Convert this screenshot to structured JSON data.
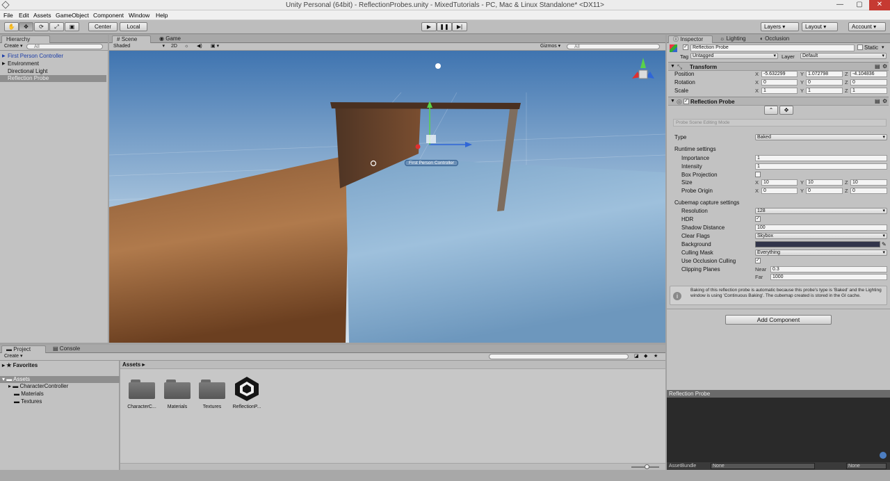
{
  "window": {
    "title": "Unity Personal (64bit) - ReflectionProbes.unity - MixedTutorials - PC, Mac & Linux Standalone* <DX11>"
  },
  "menu": [
    "File",
    "Edit",
    "Assets",
    "GameObject",
    "Component",
    "Window",
    "Help"
  ],
  "toolbar": {
    "pivot_label": "Center",
    "space_label": "Local",
    "layers_label": "Layers",
    "layout_label": "Layout",
    "account_label": "Account"
  },
  "hierarchy": {
    "tab": "Hierarchy",
    "create": "Create",
    "search_placeholder": "All",
    "items": [
      {
        "label": "First Person Controller",
        "selected": false
      },
      {
        "label": "Environment",
        "selected": false
      },
      {
        "label": "Directional Light",
        "selected": false
      },
      {
        "label": "Reflection Probe",
        "selected": true
      }
    ]
  },
  "scene": {
    "tab_scene": "Scene",
    "tab_game": "Game",
    "shading": "Shaded",
    "mode_2d": "2D",
    "gizmos": "Gizmos",
    "search_placeholder": "All",
    "object_label": "First Person Controller"
  },
  "inspector": {
    "tab_inspector": "Inspector",
    "tab_lighting": "Lighting",
    "tab_occlusion": "Occlusion",
    "object_name": "Reflection Probe",
    "static_label": "Static",
    "tag_label": "Tag",
    "tag_value": "Untagged",
    "layer_label": "Layer",
    "layer_value": "Default",
    "transform": {
      "title": "Transform",
      "position": {
        "label": "Position",
        "x": "-5.632299",
        "y": "1.072798",
        "z": "-4.104836"
      },
      "rotation": {
        "label": "Rotation",
        "x": "0",
        "y": "0",
        "z": "0"
      },
      "scale": {
        "label": "Scale",
        "x": "1",
        "y": "1",
        "z": "1"
      }
    },
    "probe": {
      "title": "Reflection Probe",
      "editing_mode": "Probe Scene Editing Mode",
      "type_label": "Type",
      "type_value": "Baked",
      "runtime_settings": "Runtime settings",
      "importance_label": "Importance",
      "importance_value": "1",
      "intensity_label": "Intensity",
      "intensity_value": "1",
      "box_projection_label": "Box Projection",
      "size": {
        "label": "Size",
        "x": "10",
        "y": "10",
        "z": "10"
      },
      "origin": {
        "label": "Probe Origin",
        "x": "0",
        "y": "0",
        "z": "0"
      },
      "cubemap_settings": "Cubemap capture settings",
      "resolution_label": "Resolution",
      "resolution_value": "128",
      "hdr_label": "HDR",
      "shadow_distance_label": "Shadow Distance",
      "shadow_distance_value": "100",
      "clear_flags_label": "Clear Flags",
      "clear_flags_value": "Skybox",
      "background_label": "Background",
      "background_color": "#31344a",
      "culling_mask_label": "Culling Mask",
      "culling_mask_value": "Everything",
      "occlusion_culling_label": "Use Occlusion Culling",
      "clipping_planes_label": "Clipping Planes",
      "near_label": "Near",
      "near_value": "0.3",
      "far_label": "Far",
      "far_value": "1000",
      "info_text": "Baking of this reflection probe is automatic because this probe's type is 'Baked' and the Lighting window is using 'Continuous Baking'. The cubemap created is stored in the GI cache."
    },
    "add_component": "Add Component",
    "preview_title": "Reflection Probe",
    "asset_bundle_label": "AssetBundle",
    "asset_bundle_value": "None",
    "asset_bundle_variant": "None"
  },
  "project": {
    "tab_project": "Project",
    "tab_console": "Console",
    "create": "Create",
    "favorites": "Favorites",
    "assets_root": "Assets",
    "tree": [
      "CharacterController",
      "Materials",
      "Textures"
    ],
    "breadcrumb": "Assets",
    "items": [
      {
        "label": "CharacterC...",
        "kind": "folder"
      },
      {
        "label": "Materials",
        "kind": "folder"
      },
      {
        "label": "Textures",
        "kind": "folder"
      },
      {
        "label": "ReflectionP...",
        "kind": "unity-scene"
      }
    ]
  }
}
